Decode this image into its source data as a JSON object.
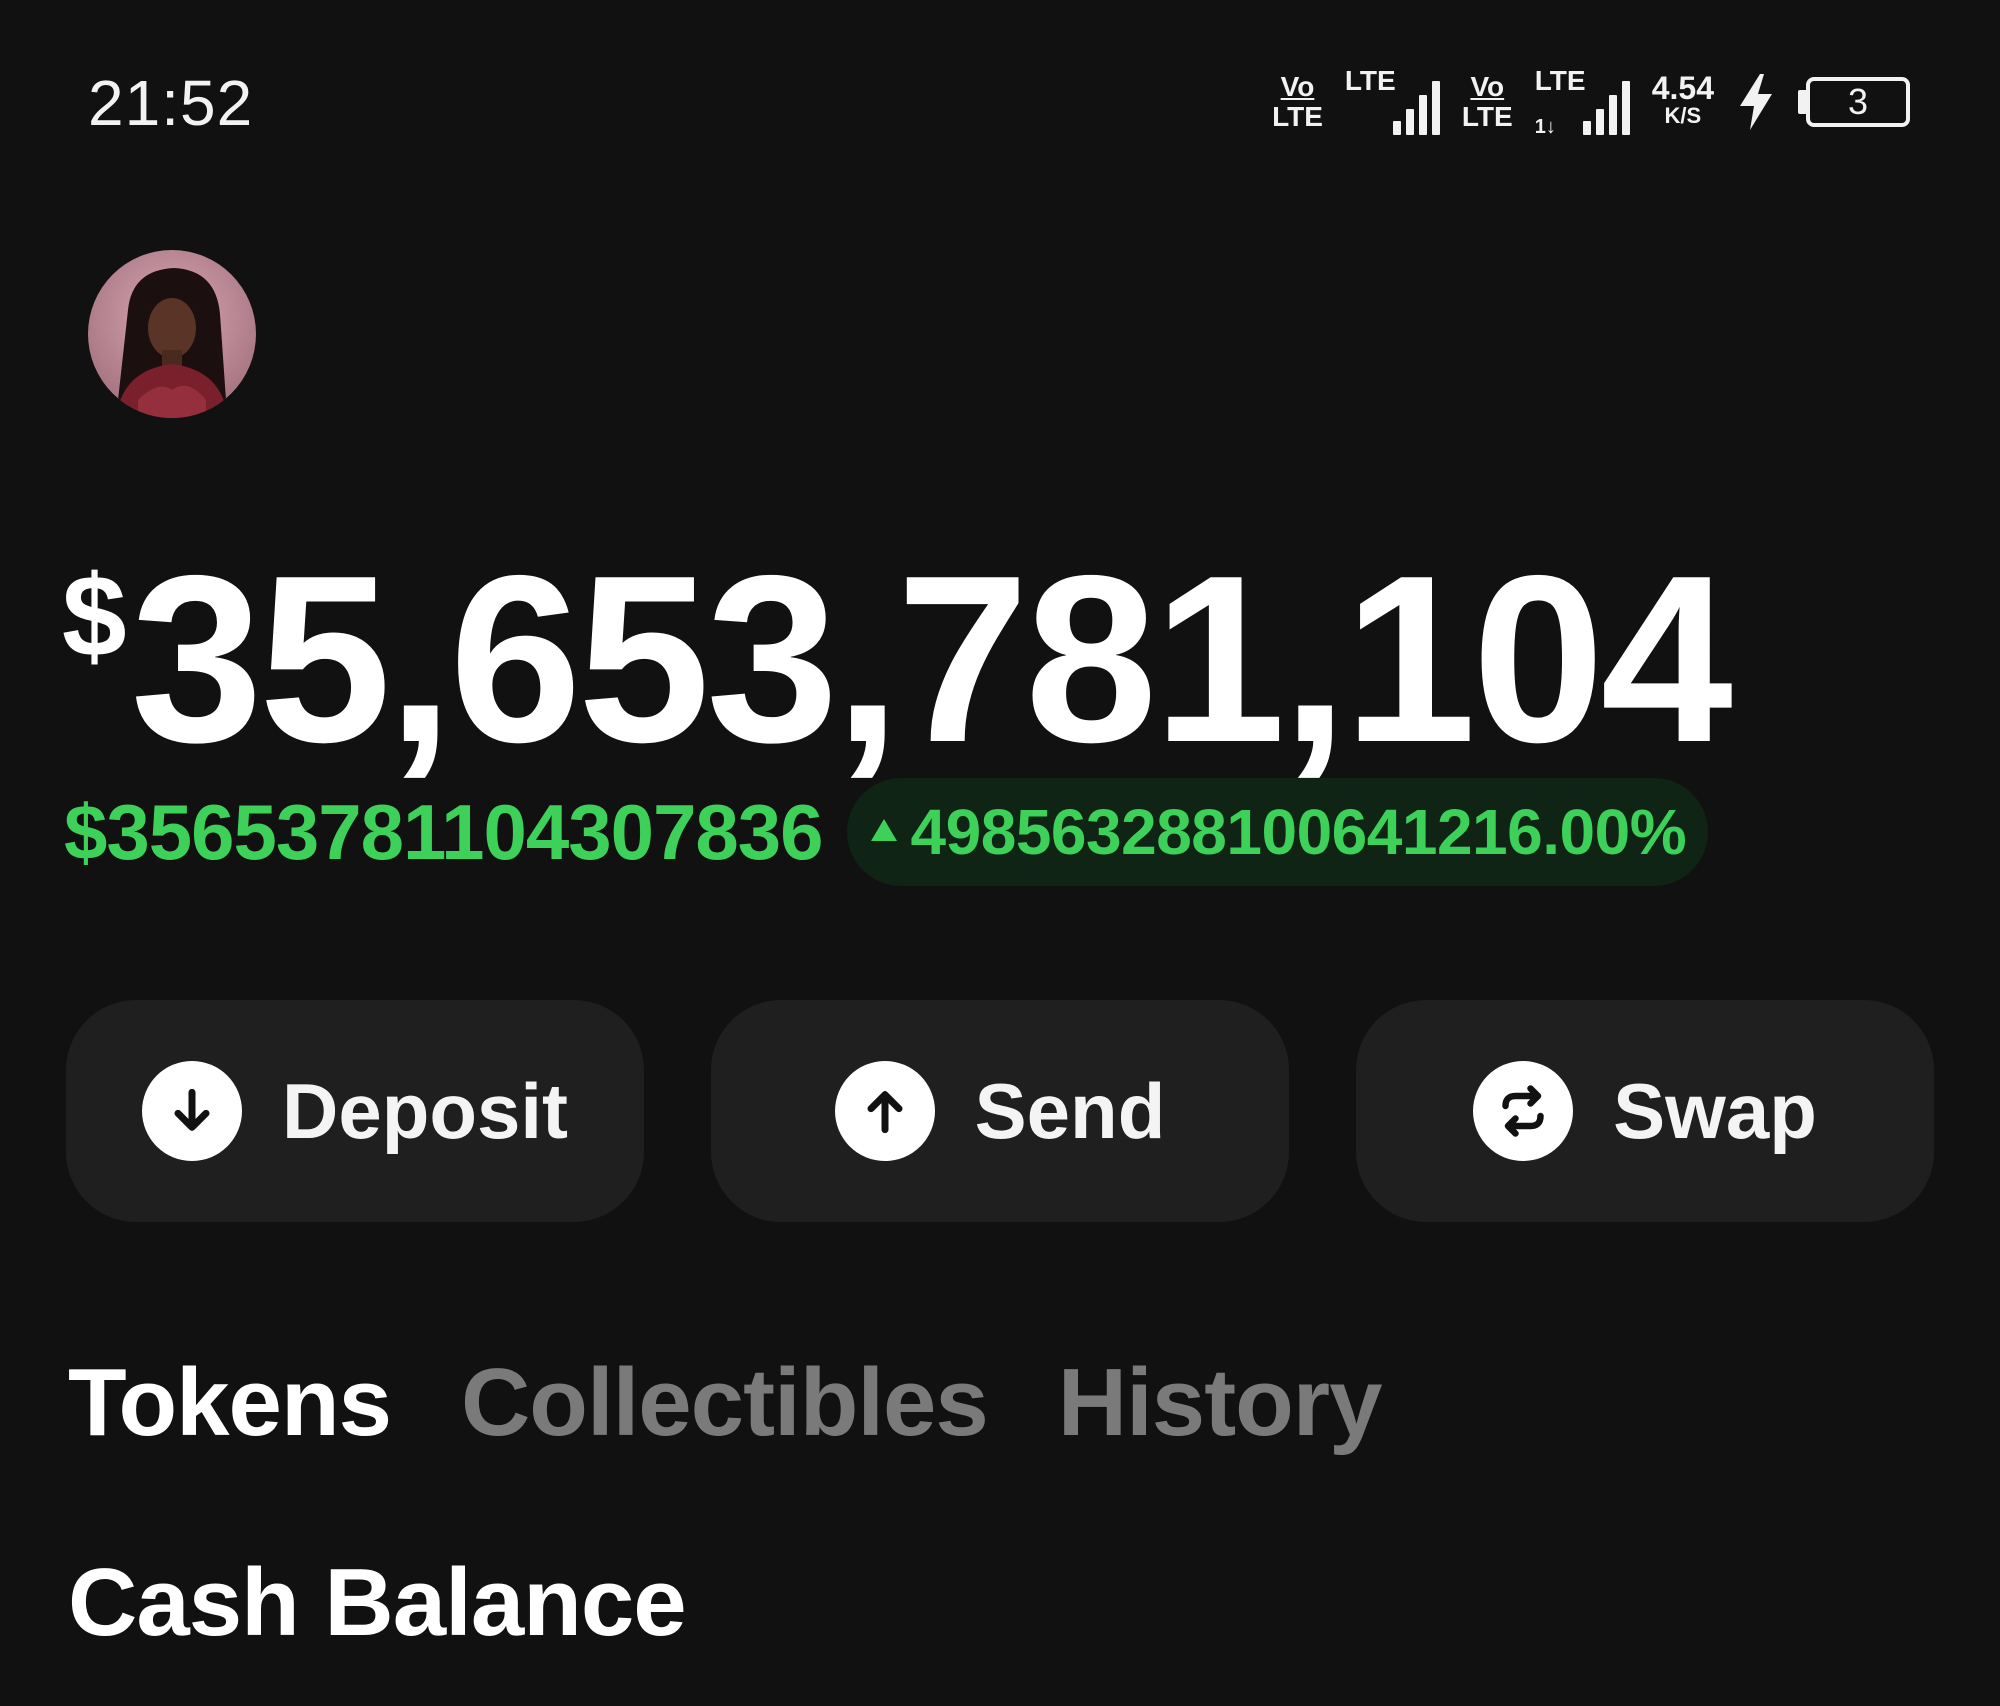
{
  "status_bar": {
    "time": "21:52",
    "sim1_volte_top": "Vo",
    "sim1_volte_bottom": "LTE",
    "sim1_network": "LTE",
    "sim2_volte_top": "Vo",
    "sim2_volte_bottom": "LTE",
    "sim2_network": "LTE",
    "sim2_sub": "1↓",
    "net_speed_value": "4.54",
    "net_speed_unit": "K/S",
    "battery_level": "3",
    "charging_icon": "lightning-bolt-icon"
  },
  "avatar": {
    "icon": "profile-avatar"
  },
  "balance": {
    "currency_symbol": "$",
    "amount": "35,653,781,104"
  },
  "change": {
    "amount": "$35653781104307836",
    "direction_icon": "triangle-up-icon",
    "percent": "4985632881006 41216.00%"
  },
  "actions": [
    {
      "label": "Deposit",
      "icon": "arrow-down-circle-icon"
    },
    {
      "label": "Send",
      "icon": "arrow-up-circle-icon"
    },
    {
      "label": "Swap",
      "icon": "swap-arrows-circle-icon"
    }
  ],
  "tabs": [
    {
      "label": "Tokens",
      "active": true
    },
    {
      "label": "Collectibles",
      "active": false
    },
    {
      "label": "History",
      "active": false
    }
  ],
  "section": {
    "title": "Cash Balance"
  },
  "colors": {
    "background": "#111111",
    "positive": "#3dd15a",
    "button_bg": "#1f1f1f",
    "inactive_tab": "#7a7a7a"
  }
}
